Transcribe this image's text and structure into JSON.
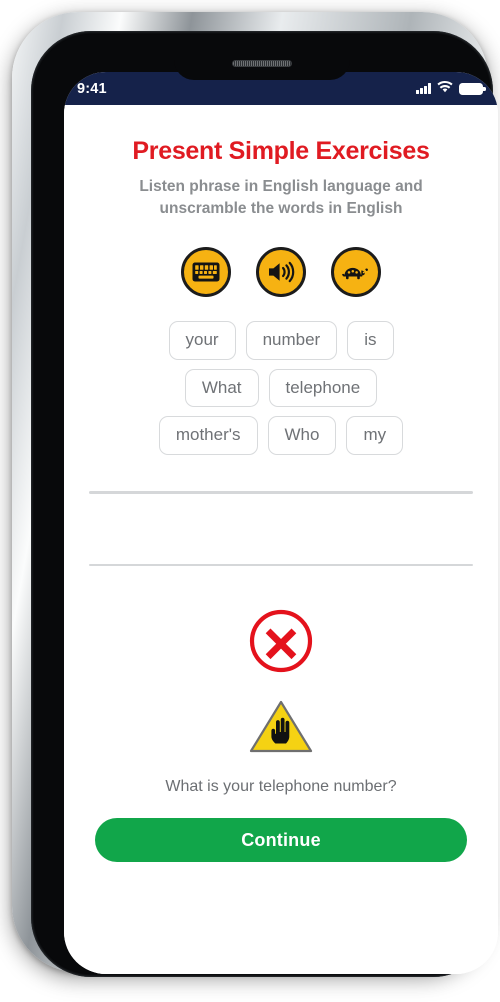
{
  "status_bar": {
    "time": "9:41",
    "signal_icon": "signal-bars-icon",
    "wifi_icon": "wifi-icon",
    "battery_icon": "battery-icon"
  },
  "app": {
    "title": "Present Simple Exercises",
    "subtitle": "Listen phrase in English language and unscramble the words in English",
    "title_color": "#e01b22",
    "subtitle_color": "#8a8d90"
  },
  "audio_controls": {
    "accent_color": "#f6b212",
    "buttons": [
      {
        "name": "keyboard-button",
        "icon": "keyboard-icon",
        "label": "Keyboard"
      },
      {
        "name": "speaker-button",
        "icon": "speaker-icon",
        "label": "Play audio"
      },
      {
        "name": "turtle-button",
        "icon": "turtle-icon",
        "label": "Play slow"
      }
    ]
  },
  "word_bank": {
    "rows": [
      [
        "your",
        "number",
        "is"
      ],
      [
        "What",
        "telephone"
      ],
      [
        "mother's",
        "Who",
        "my"
      ]
    ]
  },
  "answer_area": {
    "lines": [
      "",
      ""
    ]
  },
  "feedback": {
    "result_icon": "error-circle-x-icon",
    "result_color": "#e4121c",
    "warning_icon": "warning-triangle-hand-icon",
    "warning_color": "#f5d213",
    "correct_answer": "What is your telephone number?"
  },
  "continue_button": {
    "label": "Continue",
    "color": "#11a64a"
  }
}
